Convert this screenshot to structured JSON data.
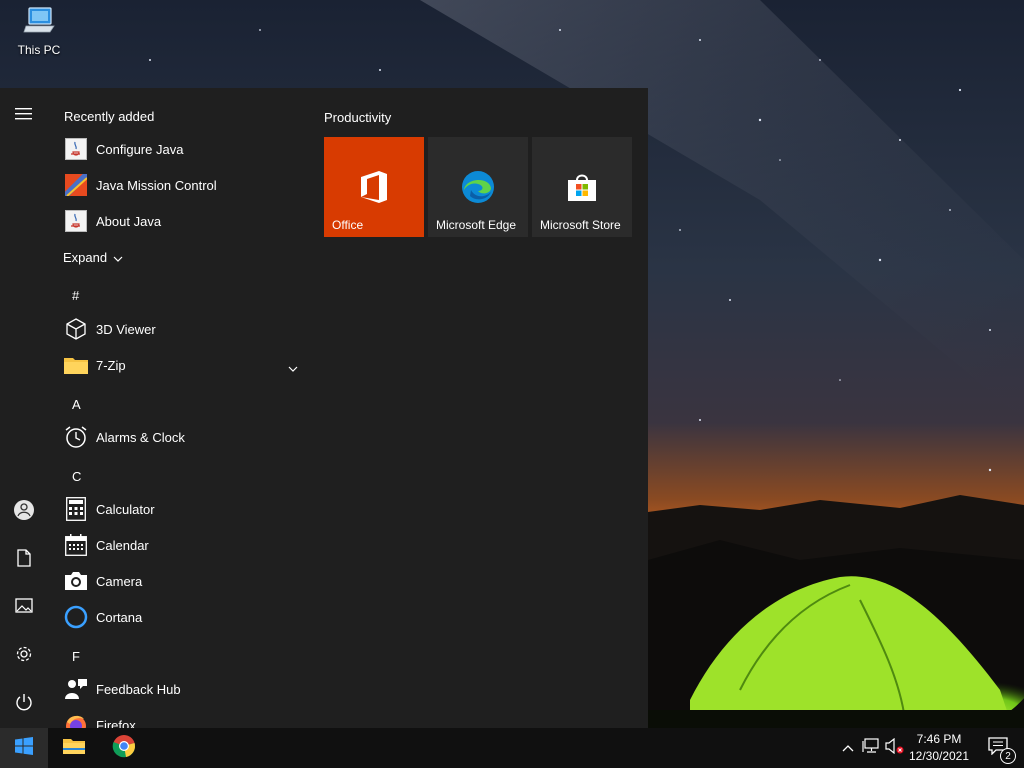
{
  "desktop": {
    "icons": [
      {
        "label": "This PC",
        "icon": "computer-icon"
      }
    ]
  },
  "start_menu": {
    "rail": [
      "menu-icon",
      "user-icon",
      "documents-icon",
      "pictures-icon",
      "settings-icon",
      "power-icon"
    ],
    "recently_added": {
      "header": "Recently added",
      "items": [
        {
          "label": "Configure Java",
          "icon": "java-icon"
        },
        {
          "label": "Java Mission Control",
          "icon": "java-mission-control-icon"
        },
        {
          "label": "About Java",
          "icon": "java-icon"
        }
      ]
    },
    "expand_label": "Expand",
    "groups": [
      {
        "letter": "#",
        "items": [
          {
            "label": "3D Viewer",
            "icon": "cube-icon"
          },
          {
            "label": "7-Zip",
            "icon": "folder-icon",
            "expandable": true
          }
        ]
      },
      {
        "letter": "A",
        "items": [
          {
            "label": "Alarms & Clock",
            "icon": "alarm-clock-icon"
          }
        ]
      },
      {
        "letter": "C",
        "items": [
          {
            "label": "Calculator",
            "icon": "calculator-icon"
          },
          {
            "label": "Calendar",
            "icon": "calendar-icon"
          },
          {
            "label": "Camera",
            "icon": "camera-icon"
          },
          {
            "label": "Cortana",
            "icon": "cortana-icon"
          }
        ]
      },
      {
        "letter": "F",
        "items": [
          {
            "label": "Feedback Hub",
            "icon": "feedback-icon"
          },
          {
            "label": "Firefox",
            "icon": "firefox-icon"
          }
        ]
      }
    ],
    "tiles": {
      "group_title": "Productivity",
      "items": [
        {
          "label": "Office",
          "icon": "office-icon",
          "color": "#d83b01"
        },
        {
          "label": "Microsoft Edge",
          "icon": "edge-icon",
          "color": "#2b2b2b"
        },
        {
          "label": "Microsoft Store",
          "icon": "store-icon",
          "color": "#2b2b2b"
        }
      ]
    }
  },
  "taskbar": {
    "pinned": [
      "windows-start-icon",
      "file-explorer-icon",
      "chrome-icon"
    ],
    "tray": [
      "chevron-up-icon",
      "network-icon",
      "volume-muted-icon"
    ],
    "time": "7:46 PM",
    "date": "12/30/2021",
    "notification_count": "2"
  },
  "colors": {
    "menu_bg": "#1f1f1f",
    "taskbar_bg": "#101010",
    "office_tile": "#d83b01",
    "tile_bg": "#2b2b2b"
  }
}
